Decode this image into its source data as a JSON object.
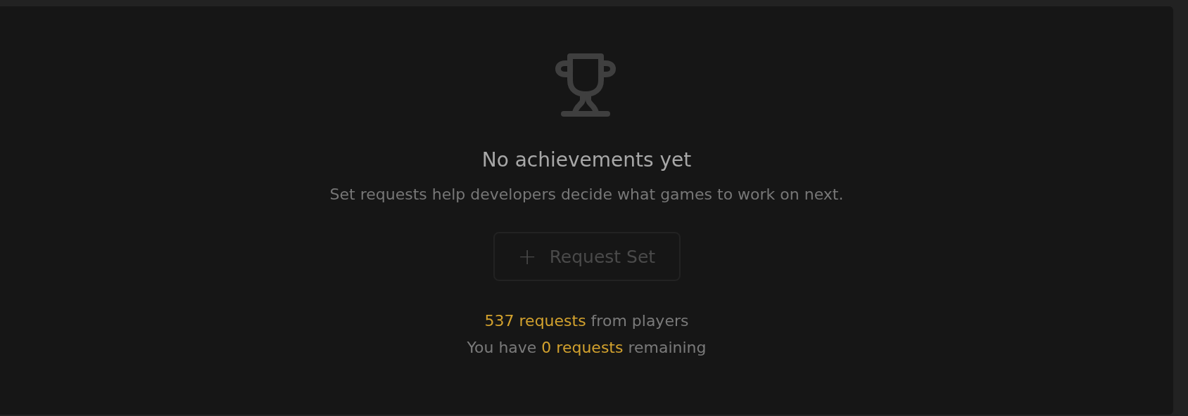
{
  "empty_state": {
    "title": "No achievements yet",
    "description": "Set requests help developers decide what games to work on next.",
    "button": {
      "icon": "+",
      "label": "Request Set",
      "disabled": true
    },
    "stats": [
      {
        "parts": [
          {
            "text": "537 requests",
            "highlight": true
          },
          {
            "text": " from players",
            "highlight": false
          }
        ]
      },
      {
        "parts": [
          {
            "text": "You have ",
            "highlight": false
          },
          {
            "text": "0 requests",
            "highlight": true
          },
          {
            "text": " remaining",
            "highlight": false
          }
        ]
      }
    ]
  }
}
